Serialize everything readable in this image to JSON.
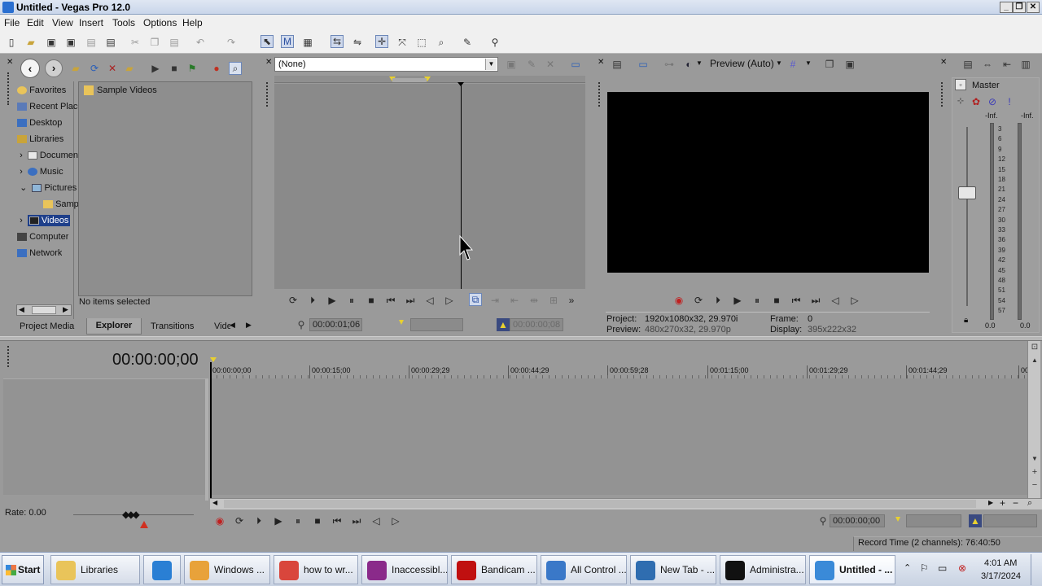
{
  "window": {
    "title": "Untitled - Vegas Pro 12.0",
    "controls": [
      "_",
      "❐",
      "✕"
    ]
  },
  "menu": [
    "File",
    "Edit",
    "View",
    "Insert",
    "Tools",
    "Options",
    "Help"
  ],
  "explorer": {
    "tree": [
      {
        "label": "Favorites",
        "icon": "star-icon"
      },
      {
        "label": "Recent Places",
        "icon": "recent-icon"
      },
      {
        "label": "Desktop",
        "icon": "desktop-icon"
      },
      {
        "label": "Libraries",
        "icon": "library-icon"
      },
      {
        "label": "Documents",
        "icon": "documents-icon"
      },
      {
        "label": "Music",
        "icon": "music-icon"
      },
      {
        "label": "Pictures",
        "icon": "pictures-icon"
      },
      {
        "label": "Sample Pictures",
        "icon": "folder-icon"
      },
      {
        "label": "Videos",
        "icon": "videos-icon"
      },
      {
        "label": "Computer",
        "icon": "computer-icon"
      },
      {
        "label": "Network",
        "icon": "network-icon"
      }
    ],
    "files": [
      {
        "label": "Sample Videos",
        "icon": "folder-icon"
      }
    ],
    "status": "No items selected",
    "tabs": [
      "Project Media",
      "Explorer",
      "Transitions",
      "Video FX"
    ],
    "active_tab": "Explorer"
  },
  "trimmer": {
    "preset": "(None)",
    "time": "00:00:01;06",
    "out_time": "00:00:00;08"
  },
  "preview": {
    "mode": "Preview (Auto)",
    "project_label": "Project:",
    "project_value": "1920x1080x32, 29.970i",
    "preview_label": "Preview:",
    "preview_value": "480x270x32, 29.970p",
    "frame_label": "Frame:",
    "frame_value": "0",
    "display_label": "Display:",
    "display_value": "395x222x32"
  },
  "master": {
    "label": "Master",
    "left_peak": "-Inf.",
    "right_peak": "-Inf.",
    "left_val": "0.0",
    "right_val": "0.0",
    "scale": [
      "3",
      "6",
      "9",
      "12",
      "15",
      "18",
      "21",
      "24",
      "27",
      "30",
      "33",
      "36",
      "39",
      "42",
      "45",
      "48",
      "51",
      "54",
      "57"
    ]
  },
  "timeline": {
    "position": "00:00:00;00",
    "ruler": [
      "00:00:00;00",
      "00:00:15;00",
      "00:00:29;29",
      "00:00:44;29",
      "00:00:59;28",
      "00:01:15;00",
      "00:01:29;29",
      "00:01:44;29",
      "00:0"
    ],
    "rate": "Rate: 0.00",
    "transport_time": "00:00:00;00",
    "record_time": "Record Time (2 channels): 76:40:50"
  },
  "taskbar": {
    "start": "Start",
    "items": [
      {
        "label": "Libraries",
        "color": "#e9c45a"
      },
      {
        "label": "",
        "color": "#2a7fd4"
      },
      {
        "label": "Windows ...",
        "color": "#e8a23a"
      },
      {
        "label": "how to wr...",
        "color": "#d9463c"
      },
      {
        "label": "Inaccessibl...",
        "color": "#8a2a8a"
      },
      {
        "label": "Bandicam ...",
        "color": "#c01010"
      },
      {
        "label": "All Control ...",
        "color": "#3a78c8"
      },
      {
        "label": "New Tab - ...",
        "color": "#2f6db0"
      },
      {
        "label": "Administra...",
        "color": "#111111"
      },
      {
        "label": "Untitled - ...",
        "color": "#3a8ad8"
      }
    ],
    "time": "4:01 AM",
    "date": "3/17/2024"
  }
}
